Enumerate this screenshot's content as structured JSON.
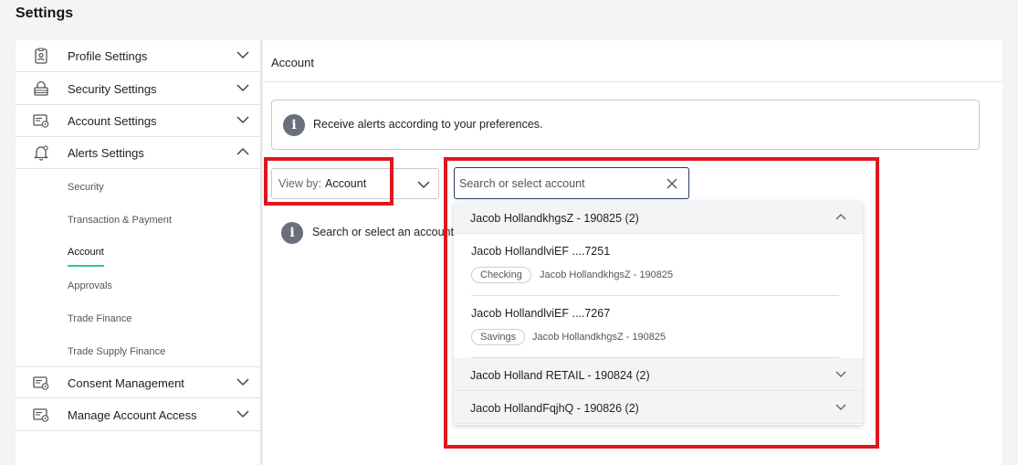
{
  "page": {
    "title": "Settings"
  },
  "sidebar": {
    "items": [
      {
        "label": "Profile Settings",
        "icon": "profile-badge-icon",
        "expanded": false
      },
      {
        "label": "Security Settings",
        "icon": "lock-icon",
        "expanded": false
      },
      {
        "label": "Account Settings",
        "icon": "account-settings-icon",
        "expanded": false
      },
      {
        "label": "Alerts Settings",
        "icon": "bell-gear-icon",
        "expanded": true
      },
      {
        "label": "Consent Management",
        "icon": "consent-settings-icon",
        "expanded": false
      },
      {
        "label": "Manage Account Access",
        "icon": "account-access-icon",
        "expanded": false
      }
    ],
    "alerts_subitems": [
      {
        "label": "Security"
      },
      {
        "label": "Transaction & Payment"
      },
      {
        "label": "Account",
        "active": true
      },
      {
        "label": "Approvals"
      },
      {
        "label": "Trade Finance"
      },
      {
        "label": "Trade Supply Finance"
      }
    ]
  },
  "main": {
    "title": "Account",
    "info_text": "Receive alerts according to your preferences.",
    "viewby_label": "View by:",
    "viewby_value": "Account",
    "search_placeholder": "Search or select account",
    "empty_hint": "Search or select an account"
  },
  "dropdown": {
    "groups": [
      {
        "label": "Jacob HollandkhgsZ - 190825 (2)",
        "expanded": true,
        "accounts": [
          {
            "name": "Jacob HollandlviEF ....7251",
            "type": "Checking",
            "owner": "Jacob HollandkhgsZ - 190825"
          },
          {
            "name": "Jacob HollandlviEF ....7267",
            "type": "Savings",
            "owner": "Jacob HollandkhgsZ - 190825"
          }
        ]
      },
      {
        "label": "Jacob Holland RETAIL - 190824 (2)",
        "expanded": false
      },
      {
        "label": "Jacob HollandFqjhQ - 190826 (2)",
        "expanded": false
      }
    ]
  },
  "colors": {
    "accent": "#2fc4a6",
    "highlight": "#e0161e",
    "focus_border": "#2b3a6b",
    "info_icon": "#6b6f7d"
  }
}
